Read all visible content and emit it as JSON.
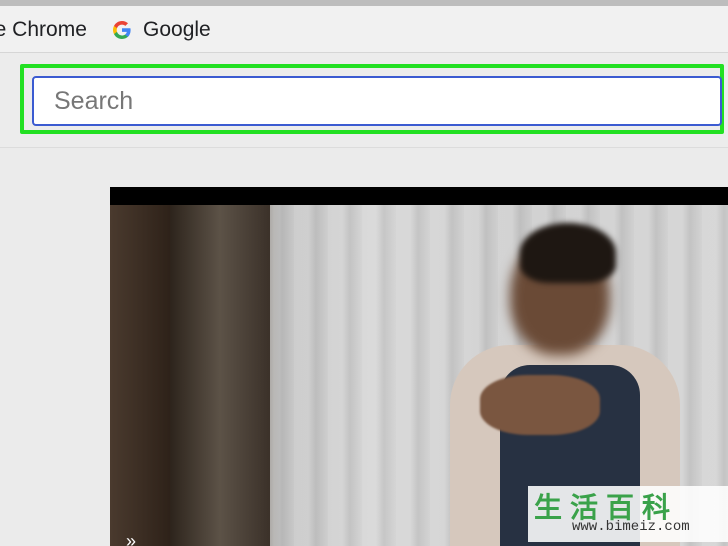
{
  "bookmarks_bar": {
    "items": [
      {
        "label": "le Chrome",
        "icon": "none"
      },
      {
        "label": "Google",
        "icon": "google-g-icon"
      }
    ]
  },
  "search": {
    "placeholder": "Search",
    "value": "",
    "highlight_color": "#22e022",
    "border_color": "#3b5bd1"
  },
  "video": {
    "control_glyph": "»"
  },
  "watermark": {
    "chars": "生活百科",
    "url": "www.bimeiz.com"
  }
}
